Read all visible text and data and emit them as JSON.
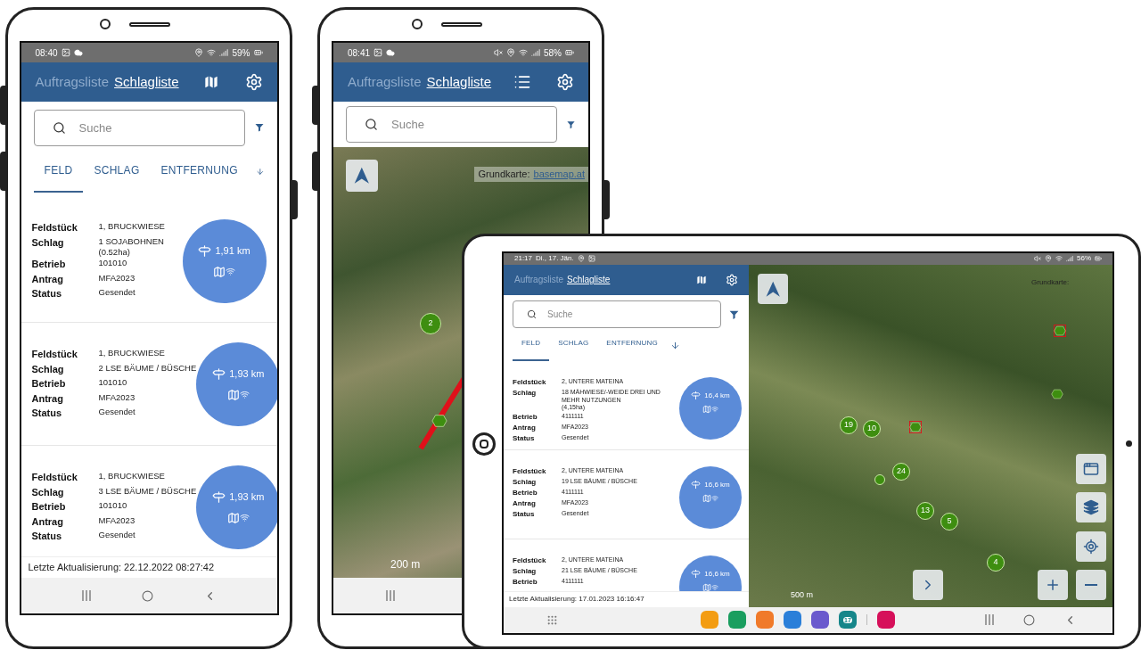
{
  "devices": [
    {
      "kind": "phone-list",
      "status_bar": {
        "time": "08:40",
        "battery": "59%"
      },
      "header": {
        "tabs": [
          {
            "label": "Auftragsliste",
            "selected": false
          },
          {
            "label": "Schlagliste",
            "selected": true
          }
        ],
        "showing_map": false
      },
      "search": {
        "placeholder": "Suche"
      },
      "sort_tabs": [
        {
          "label": "FELD",
          "selected": true
        },
        {
          "label": "SCHLAG",
          "selected": false
        },
        {
          "label": "ENTFERNUNG",
          "selected": false
        }
      ],
      "records": [
        {
          "fields": [
            {
              "label": "Feldstück",
              "value": "1,  BRUCKWIESE"
            },
            {
              "label": "Schlag",
              "value": "1  SOJABOHNEN",
              "note": "(0.52ha)"
            },
            {
              "label": "Betrieb",
              "value": "101010"
            },
            {
              "label": "Antrag",
              "value": "MFA2023"
            },
            {
              "label": "Status",
              "value": "Gesendet"
            }
          ],
          "distance": "1,91 km"
        },
        {
          "fields": [
            {
              "label": "Feldstück",
              "value": "1,  BRUCKWIESE"
            },
            {
              "label": "Schlag",
              "value": "2  LSE BÄUME / BÜSCHE"
            },
            {
              "label": "Betrieb",
              "value": "101010"
            },
            {
              "label": "Antrag",
              "value": "MFA2023"
            },
            {
              "label": "Status",
              "value": "Gesendet"
            }
          ],
          "distance": "1,93 km"
        },
        {
          "fields": [
            {
              "label": "Feldstück",
              "value": "1,  BRUCKWIESE"
            },
            {
              "label": "Schlag",
              "value": "3  LSE BÄUME / BÜSCHE"
            },
            {
              "label": "Betrieb",
              "value": "101010"
            },
            {
              "label": "Antrag",
              "value": "MFA2023"
            },
            {
              "label": "Status",
              "value": "Gesendet"
            }
          ],
          "distance": "1,93 km"
        }
      ],
      "footer": "Letzte Aktualisierung: 22.12.2022 08:27:42"
    },
    {
      "kind": "phone-map",
      "status_bar": {
        "time": "08:41",
        "battery": "58%"
      },
      "header": {
        "tabs": [
          {
            "label": "Auftragsliste",
            "selected": false
          },
          {
            "label": "Schlagliste",
            "selected": true
          }
        ],
        "showing_map": true
      },
      "search": {
        "placeholder": "Suche"
      },
      "map": {
        "attribution": "Grundkarte:",
        "attribution_link": "basemap.at",
        "scale": "200 m",
        "markers": [
          {
            "kind": "cluster",
            "label": "2"
          },
          {
            "kind": "hexagon",
            "highlighted": false
          }
        ]
      }
    },
    {
      "kind": "tablet",
      "status_bar": {
        "time": "21:17",
        "date": "Di., 17. Jän.",
        "battery": "56%"
      },
      "header": {
        "tabs": [
          {
            "label": "Auftragsliste",
            "selected": false
          },
          {
            "label": "Schlagliste",
            "selected": true
          }
        ],
        "showing_map": false
      },
      "search": {
        "placeholder": "Suche"
      },
      "sort_tabs": [
        {
          "label": "FELD",
          "selected": true
        },
        {
          "label": "SCHLAG",
          "selected": false
        },
        {
          "label": "ENTFERNUNG",
          "selected": false
        }
      ],
      "records": [
        {
          "fields": [
            {
              "label": "Feldstück",
              "value": "2,  UNTERE MATEINA"
            },
            {
              "label": "Schlag",
              "value": "18  MÄHWIESE/-WEIDE DREI UND MEHR NUTZUNGEN",
              "note": "(4,15ha)"
            },
            {
              "label": "Betrieb",
              "value": "4111111"
            },
            {
              "label": "Antrag",
              "value": "MFA2023"
            },
            {
              "label": "Status",
              "value": "Gesendet"
            }
          ],
          "distance": "16,4 km"
        },
        {
          "fields": [
            {
              "label": "Feldstück",
              "value": "2,  UNTERE MATEINA"
            },
            {
              "label": "Schlag",
              "value": "19  LSE BÄUME / BÜSCHE"
            },
            {
              "label": "Betrieb",
              "value": "4111111"
            },
            {
              "label": "Antrag",
              "value": "MFA2023"
            },
            {
              "label": "Status",
              "value": "Gesendet"
            }
          ],
          "distance": "16,6 km"
        },
        {
          "fields": [
            {
              "label": "Feldstück",
              "value": "2,  UNTERE MATEINA"
            },
            {
              "label": "Schlag",
              "value": "21  LSE BÄUME / BÜSCHE"
            },
            {
              "label": "Betrieb",
              "value": "4111111"
            }
          ],
          "distance": "16,6 km"
        }
      ],
      "footer": "Letzte Aktualisierung: 17.01.2023 16:16:47",
      "map": {
        "attribution": "Grundkarte:",
        "scale": "500 m",
        "markers": [
          {
            "kind": "cluster",
            "label": "19"
          },
          {
            "kind": "cluster",
            "label": "10"
          },
          {
            "kind": "hexagon",
            "highlighted": true
          },
          {
            "kind": "hexagon",
            "highlighted": true
          },
          {
            "kind": "hexagon",
            "highlighted": false
          },
          {
            "kind": "cluster"
          },
          {
            "kind": "cluster",
            "label": "24"
          },
          {
            "kind": "cluster",
            "label": "13"
          },
          {
            "kind": "cluster",
            "label": "5"
          },
          {
            "kind": "cluster",
            "label": "4"
          }
        ]
      },
      "taskbar": {
        "apps": [
          {
            "color": "#f39c12"
          },
          {
            "color": "#1a9e5f"
          },
          {
            "color": "#f07a2a"
          },
          {
            "color": "#2a7fd9"
          },
          {
            "color": "#6a5acd"
          },
          {
            "color": "#16868a",
            "label": "17"
          },
          {
            "color": "#d6105a"
          }
        ]
      }
    }
  ]
}
